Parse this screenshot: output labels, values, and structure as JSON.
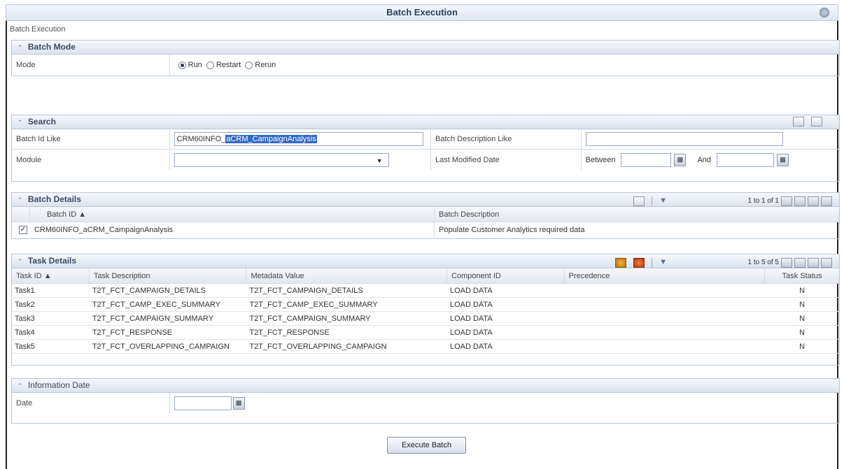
{
  "header": {
    "title": "Batch Execution",
    "subtitle": "Batch Execution"
  },
  "batch_mode": {
    "section_title": "Batch Mode",
    "mode_label": "Mode",
    "options": [
      "Run",
      "Restart",
      "Rerun"
    ],
    "selected": "Run"
  },
  "search": {
    "section_title": "Search",
    "batch_id_label": "Batch Id Like",
    "batch_id_prefix": "CRM60INFO_",
    "batch_id_value": "aCRM_CampaignAnalysis",
    "batch_desc_label": "Batch Description Like",
    "batch_desc_value": "",
    "module_label": "Module",
    "module_value": "",
    "last_modified_label": "Last Modified Date",
    "between_label": "Between",
    "and_label": "And"
  },
  "batch_details": {
    "section_title": "Batch Details",
    "pager_text": "1 to 1 of 1",
    "columns": [
      "Batch ID ▲",
      "Batch Description"
    ],
    "rows": [
      {
        "batch_id": "CRM60INFO_aCRM_CampaignAnalysis",
        "description": "Populate Customer Analytics required data",
        "checked": true
      }
    ]
  },
  "task_details": {
    "section_title": "Task Details",
    "pager_text": "1 to 5 of 5",
    "columns": [
      "Task ID ▲",
      "Task Description",
      "Metadata Value",
      "Component ID",
      "Precedence",
      "Task Status"
    ],
    "rows": [
      {
        "id": "Task1",
        "desc": "T2T_FCT_CAMPAIGN_DETAILS",
        "meta": "T2T_FCT_CAMPAIGN_DETAILS",
        "component": "LOAD DATA",
        "precedence": "",
        "status": "N"
      },
      {
        "id": "Task2",
        "desc": "T2T_FCT_CAMP_EXEC_SUMMARY",
        "meta": "T2T_FCT_CAMP_EXEC_SUMMARY",
        "component": "LOAD DATA",
        "precedence": "",
        "status": "N"
      },
      {
        "id": "Task3",
        "desc": "T2T_FCT_CAMPAIGN_SUMMARY",
        "meta": "T2T_FCT_CAMPAIGN_SUMMARY",
        "component": "LOAD DATA",
        "precedence": "",
        "status": "N"
      },
      {
        "id": "Task4",
        "desc": "T2T_FCT_RESPONSE",
        "meta": "T2T_FCT_RESPONSE",
        "component": "LOAD DATA",
        "precedence": "",
        "status": "N"
      },
      {
        "id": "Task5",
        "desc": "T2T_FCT_OVERLAPPING_CAMPAIGN",
        "meta": "T2T_FCT_OVERLAPPING_CAMPAIGN",
        "component": "LOAD DATA",
        "precedence": "",
        "status": "N"
      }
    ]
  },
  "information_date": {
    "section_title": "Information Date",
    "date_label": "Date",
    "date_value": ""
  },
  "actions": {
    "execute_label": "Execute Batch"
  },
  "colors": {
    "selection_highlight": "#316ac5",
    "header_gradient_end": "#dbe3ef",
    "border": "#b8c6da"
  }
}
